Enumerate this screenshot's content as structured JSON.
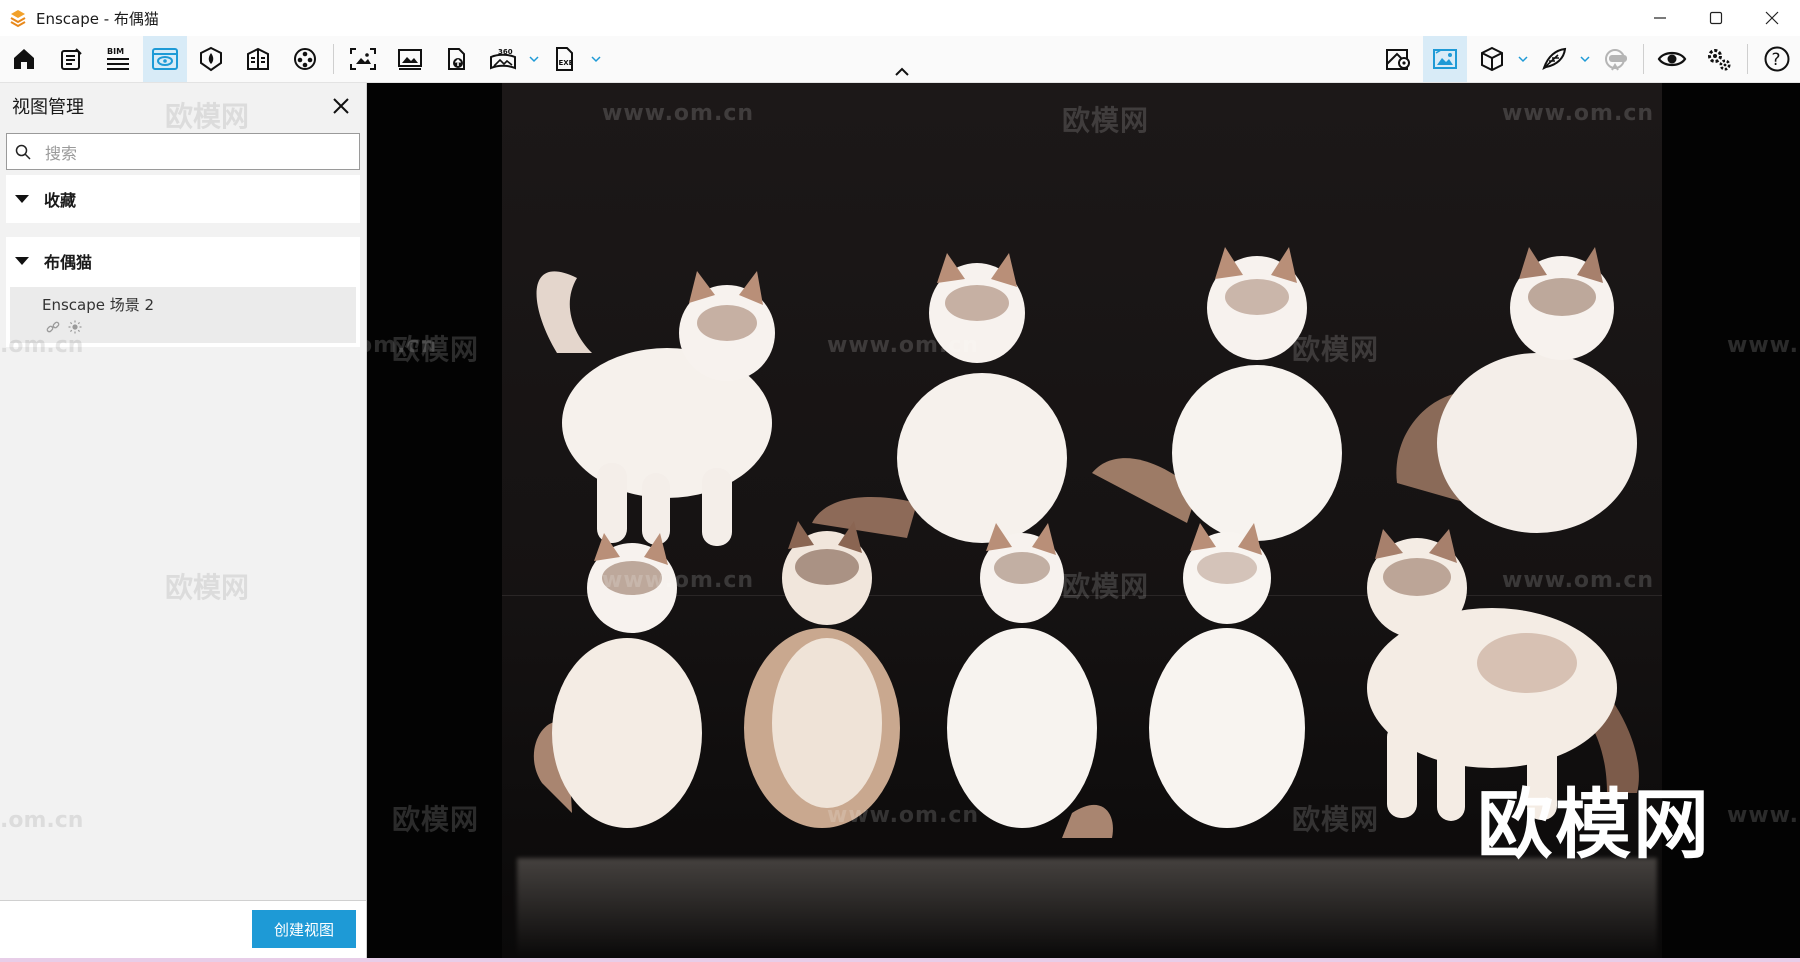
{
  "window": {
    "title": "Enscape - 布偶猫",
    "logo_icon": "enscape-logo-icon",
    "controls": [
      "minimize-icon",
      "maximize-icon",
      "close-icon"
    ]
  },
  "toolbar": {
    "left_tools": [
      {
        "name": "home-icon"
      },
      {
        "name": "asset-library-icon"
      },
      {
        "name": "bim-icon",
        "label": "BIM"
      },
      {
        "name": "view-management-icon",
        "active": true
      },
      {
        "name": "visual-settings-icon"
      },
      {
        "name": "atmosphere-icon"
      },
      {
        "name": "video-editor-icon"
      },
      {
        "name": "screenshot-icon"
      },
      {
        "name": "batch-render-icon"
      },
      {
        "name": "upload-icon"
      },
      {
        "name": "panorama-360-icon",
        "label": "360"
      },
      {
        "name": "export-exe-icon",
        "label": "EXE"
      }
    ],
    "right_tools": [
      {
        "name": "map-pin-icon"
      },
      {
        "name": "image-view-icon",
        "active": true
      },
      {
        "name": "cube-icon"
      },
      {
        "name": "feather-icon"
      },
      {
        "name": "vr-headset-icon"
      },
      {
        "name": "eye-icon"
      },
      {
        "name": "settings-gears-icon"
      },
      {
        "name": "help-icon",
        "label": "?"
      }
    ],
    "accent_color": "#1e9ad6"
  },
  "panel": {
    "title": "视图管理",
    "search": {
      "placeholder": "搜索",
      "value": ""
    },
    "sections": [
      {
        "label": "收藏"
      },
      {
        "label": "布偶猫",
        "items": [
          {
            "name": "Enscape 场景 2",
            "icons": [
              "link-icon",
              "sun-icon"
            ]
          }
        ]
      }
    ],
    "create_button": "创建视图",
    "watermarks": [
      "欧模网",
      "欧模网",
      ".om.cn",
      ".om.cn"
    ]
  },
  "viewport": {
    "scene": "布偶猫",
    "watermark_text": "欧模网",
    "watermark_url": "www.om.cn",
    "watermark_partial": "www.",
    "watermark_edge": "om.cn",
    "watermark_large": "欧模网"
  }
}
